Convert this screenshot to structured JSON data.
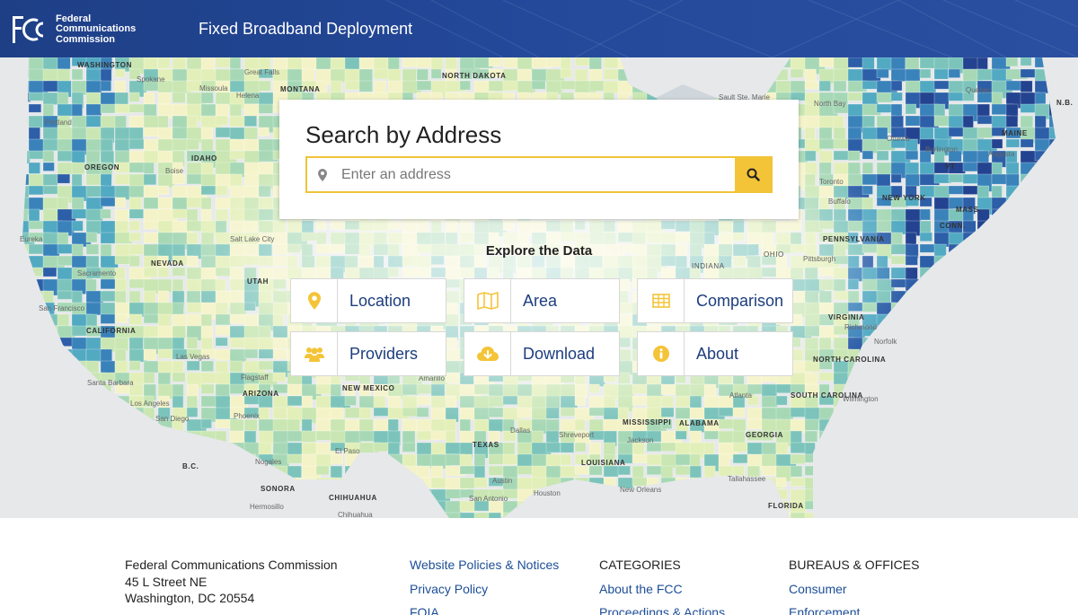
{
  "header": {
    "agency_line1": "Federal",
    "agency_line2": "Communications",
    "agency_line3": "Commission",
    "site_title": "Fixed Broadband Deployment"
  },
  "search": {
    "title": "Search by Address",
    "placeholder": "Enter an address",
    "value": ""
  },
  "explore": {
    "title": "Explore the Data",
    "tiles": [
      {
        "label": "Location",
        "icon": "map-pin-icon"
      },
      {
        "label": "Area",
        "icon": "map-icon"
      },
      {
        "label": "Comparison",
        "icon": "table-icon"
      },
      {
        "label": "Providers",
        "icon": "users-icon"
      },
      {
        "label": "Download",
        "icon": "cloud-download-icon"
      },
      {
        "label": "About",
        "icon": "info-icon"
      }
    ]
  },
  "map_labels": {
    "states": [
      "WASHINGTON",
      "MONTANA",
      "NORTH DAKOTA",
      "OREGON",
      "IDAHO",
      "NEVADA",
      "UTAH",
      "CALIFORNIA",
      "ARIZONA",
      "NEW MEXICO",
      "TEXAS",
      "LOUISIANA",
      "MISSISSIPPI",
      "ALABAMA",
      "GEORGIA",
      "SOUTH CAROLINA",
      "NORTH CAROLINA",
      "VIRGINIA",
      "PENNSYLVANIA",
      "NEW YORK",
      "OHIO",
      "INDIANA",
      "MAINE",
      "VT",
      "MASS.",
      "CONN.",
      "FLORIDA",
      "SONORA",
      "CHIHUAHUA",
      "B.C.",
      "N.B."
    ],
    "cities": [
      "Spokane",
      "Great Falls",
      "Missoula",
      "Helena",
      "Portland",
      "Boise",
      "Eureka",
      "Salt Lake City",
      "Sacramento",
      "San Francisco",
      "Las Vegas",
      "Santa Barbara",
      "Los Angeles",
      "San Diego",
      "Flagstaff",
      "Phoenix",
      "Nogales",
      "Hermosillo",
      "El Paso",
      "Chihuahua",
      "Dallas",
      "Shreveport",
      "Jackson",
      "Austin",
      "San Antonio",
      "Houston",
      "New Orleans",
      "Tallahassee",
      "Atlanta",
      "Wilmington",
      "Norfolk",
      "Richmond",
      "Pittsburgh",
      "Toronto",
      "Buffalo",
      "Ottawa",
      "Burlington",
      "Augusta",
      "Quebec",
      "North Bay",
      "Sault Ste. Marie",
      "Amarillo"
    ]
  },
  "footer": {
    "address": [
      "Federal Communications Commission",
      "45 L Street NE",
      "Washington, DC 20554"
    ],
    "links_col": [
      "Website Policies & Notices",
      "Privacy Policy",
      "FOIA"
    ],
    "categories": {
      "heading": "CATEGORIES",
      "links": [
        "About the FCC",
        "Proceedings & Actions"
      ]
    },
    "bureaus": {
      "heading": "BUREAUS & OFFICES",
      "links": [
        "Consumer",
        "Enforcement"
      ]
    }
  },
  "colors": {
    "header_blue": "#24499a",
    "accent_yellow": "#f4c438",
    "link_blue": "#1c4e97",
    "tile_text": "#1d3d7e"
  }
}
